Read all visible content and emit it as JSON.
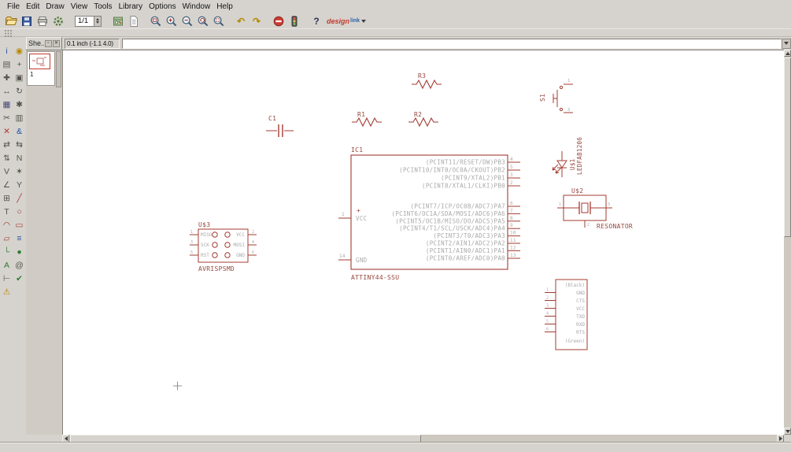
{
  "colors": {
    "part": "#a33b32",
    "ref": "#96483f",
    "pin": "#a9a9a9",
    "grid_cross": "#8f8f8f"
  },
  "menu": {
    "items": [
      "File",
      "Edit",
      "Draw",
      "View",
      "Tools",
      "Library",
      "Options",
      "Window",
      "Help"
    ]
  },
  "toolbar": {
    "sheet_combo": "1/1",
    "design_link": {
      "brand": "design",
      "sub": "link"
    },
    "items": [
      {
        "name": "open-icon",
        "kind": "folder"
      },
      {
        "name": "save-icon",
        "kind": "floppy"
      },
      {
        "name": "print-icon",
        "kind": "printer"
      },
      {
        "name": "cam-icon",
        "kind": "gear"
      },
      {
        "name": "sep"
      },
      {
        "name": "sheet-combo"
      },
      {
        "name": "sep"
      },
      {
        "name": "board-icon",
        "kind": "board"
      },
      {
        "name": "run-script-icon",
        "kind": "page"
      },
      {
        "name": "sep"
      },
      {
        "name": "zoom-fit-icon",
        "kind": "zoomfit"
      },
      {
        "name": "zoom-in-icon",
        "kind": "zoomin"
      },
      {
        "name": "zoom-out-icon",
        "kind": "zoomout"
      },
      {
        "name": "zoom-redraw-icon",
        "kind": "zoomredraw"
      },
      {
        "name": "zoom-select-icon",
        "kind": "zoomselect"
      },
      {
        "name": "sep"
      },
      {
        "name": "undo-icon",
        "kind": "glyph",
        "glyph": "↶",
        "color": "#b58900"
      },
      {
        "name": "redo-icon",
        "kind": "glyph",
        "glyph": "↷",
        "color": "#b58900"
      },
      {
        "name": "sep"
      },
      {
        "name": "stop-icon",
        "kind": "stop"
      },
      {
        "name": "traffic-light-icon",
        "kind": "traffic"
      },
      {
        "name": "sep"
      },
      {
        "name": "help-icon",
        "kind": "glyph",
        "glyph": "?",
        "color": "#333355"
      },
      {
        "name": "design-link-button",
        "kind": "design"
      }
    ]
  },
  "tabrow": {
    "sheets_tab_label": "She...",
    "float_icon": "▫",
    "close_icon": "✕",
    "coord_readout": "0.1 inch (-1.1 4.0)",
    "command_value": ""
  },
  "sheets_panel": {
    "sheet_number": "1"
  },
  "palette": {
    "items": [
      {
        "name": "info-icon",
        "glyph": "i",
        "color": "#1f4fa0"
      },
      {
        "name": "show-icon",
        "glyph": "◉",
        "color": "#b58900"
      },
      {
        "name": "display-icon",
        "glyph": "▤",
        "color": "#55524c"
      },
      {
        "name": "mark-icon",
        "glyph": "+",
        "color": "#55524c"
      },
      {
        "name": "move-icon",
        "glyph": "✚",
        "color": "#55524c"
      },
      {
        "name": "copy-icon",
        "glyph": "▣",
        "color": "#55524c"
      },
      {
        "name": "mirror-icon",
        "glyph": "↔",
        "color": "#55524c"
      },
      {
        "name": "rotate-icon",
        "glyph": "↻",
        "color": "#55524c"
      },
      {
        "name": "group-icon",
        "glyph": "▦",
        "color": "#447"
      },
      {
        "name": "change-icon",
        "glyph": "✱",
        "color": "#55524c"
      },
      {
        "name": "cut-icon",
        "glyph": "✂",
        "color": "#55524c"
      },
      {
        "name": "paste-icon",
        "glyph": "▥",
        "color": "#55524c"
      },
      {
        "name": "delete-icon",
        "glyph": "✕",
        "color": "#b03a2e"
      },
      {
        "name": "add-icon",
        "glyph": "&",
        "color": "#1f4fa0"
      },
      {
        "name": "pinswap-icon",
        "glyph": "⇄",
        "color": "#55524c"
      },
      {
        "name": "replace-icon",
        "glyph": "⇆",
        "color": "#55524c"
      },
      {
        "name": "gateswap-icon",
        "glyph": "⇅",
        "color": "#55524c"
      },
      {
        "name": "name-icon",
        "glyph": "N",
        "color": "#55524c"
      },
      {
        "name": "value-icon",
        "glyph": "V",
        "color": "#55524c"
      },
      {
        "name": "smash-icon",
        "glyph": "✶",
        "color": "#55524c"
      },
      {
        "name": "miter-icon",
        "glyph": "∠",
        "color": "#55524c"
      },
      {
        "name": "split-icon",
        "glyph": "Y",
        "color": "#55524c"
      },
      {
        "name": "invoke-icon",
        "glyph": "⊞",
        "color": "#55524c"
      },
      {
        "name": "wire-icon",
        "glyph": "╱",
        "color": "#a33b32"
      },
      {
        "name": "text-icon",
        "glyph": "T",
        "color": "#55524c"
      },
      {
        "name": "circle-icon",
        "glyph": "○",
        "color": "#a33b32"
      },
      {
        "name": "arc-icon",
        "glyph": "◠",
        "color": "#a33b32"
      },
      {
        "name": "rect-icon",
        "glyph": "▭",
        "color": "#a33b32"
      },
      {
        "name": "polygon-icon",
        "glyph": "▱",
        "color": "#a33b32"
      },
      {
        "name": "bus-icon",
        "glyph": "≡",
        "color": "#1f4fa0"
      },
      {
        "name": "net-icon",
        "glyph": "└",
        "color": "#2e7d32"
      },
      {
        "name": "junction-icon",
        "glyph": "●",
        "color": "#2e7d32"
      },
      {
        "name": "label-icon",
        "glyph": "A",
        "color": "#2e7d32"
      },
      {
        "name": "attribute-icon",
        "glyph": "@",
        "color": "#55524c"
      },
      {
        "name": "dimension-icon",
        "glyph": "⊢",
        "color": "#55524c"
      },
      {
        "name": "erc-icon",
        "glyph": "✔",
        "color": "#2e7d32"
      },
      {
        "name": "errors-icon",
        "glyph": "⚠",
        "color": "#b58900"
      }
    ]
  },
  "schematic": {
    "resistors": [
      {
        "ref": "R3"
      },
      {
        "ref": "R1"
      },
      {
        "ref": "R2"
      }
    ],
    "capacitor": {
      "ref": "C1"
    },
    "switch": {
      "ref": "S1",
      "pin_numbers": [
        "1",
        "3"
      ]
    },
    "led": {
      "ref": "U$1",
      "value": "LEDFAB1206"
    },
    "resonator": {
      "ref": "U$2",
      "value": "RESONATOR",
      "pin_numbers": [
        "1",
        "2",
        "3"
      ]
    },
    "isp": {
      "ref": "U$3",
      "value": "AVRISPSMD",
      "left_pins": [
        {
          "name": "MISO",
          "num": "1"
        },
        {
          "name": "SCK",
          "num": "3"
        },
        {
          "name": "RST",
          "num": "5"
        }
      ],
      "right_pins": [
        {
          "name": "VCC",
          "num": "2"
        },
        {
          "name": "MOSI",
          "num": "4"
        },
        {
          "name": "GND",
          "num": "6"
        }
      ]
    },
    "mcu": {
      "ref": "IC1",
      "value": "ATTINY44-SSU",
      "left_pins": [
        {
          "name": "VCC",
          "num": "1",
          "plus": "+"
        },
        {
          "name": "GND",
          "num": "14"
        }
      ],
      "right_pins_top": [
        {
          "name": "(PCINT11/RESET/DW)PB3",
          "num": "4"
        },
        {
          "name": "(PCINT10/INT0/OC0A/CKOUT)PB2",
          "num": "5"
        },
        {
          "name": "(PCINT9/XTAL2)PB1",
          "num": "3"
        },
        {
          "name": "(PCINT8/XTAL1/CLKI)PB0",
          "num": "2"
        }
      ],
      "right_pins_bottom": [
        {
          "name": "(PCINT7/ICP/OC0B/ADC7)PA7",
          "num": "6"
        },
        {
          "name": "(PCINT6/OC1A/SDA/MOSI/ADC6)PA6",
          "num": "7"
        },
        {
          "name": "(PCINT5/OC1B/MISO/DO/ADC5)PA5",
          "num": "8"
        },
        {
          "name": "(PCINT4/T1/SCL/USCK/ADC4)PA4",
          "num": "9"
        },
        {
          "name": "(PCINT3/T0/ADC3)PA3",
          "num": "10"
        },
        {
          "name": "(PCINT2/AIN1/ADC2)PA2",
          "num": "11"
        },
        {
          "name": "(PCINT1/AIN0/ADC1)PA1",
          "num": "12"
        },
        {
          "name": "(PCINT0/AREF/ADC0)PA0",
          "num": "13"
        }
      ]
    },
    "ftdi": {
      "pins": [
        {
          "name": "(Black)"
        },
        {
          "name": "GND",
          "num": "1"
        },
        {
          "name": "CTS",
          "num": "2"
        },
        {
          "name": "VCC",
          "num": "3"
        },
        {
          "name": "TXD",
          "num": "4"
        },
        {
          "name": "RXD",
          "num": "5"
        },
        {
          "name": "RTS",
          "num": "6"
        },
        {
          "name": "(Green)"
        }
      ]
    }
  }
}
